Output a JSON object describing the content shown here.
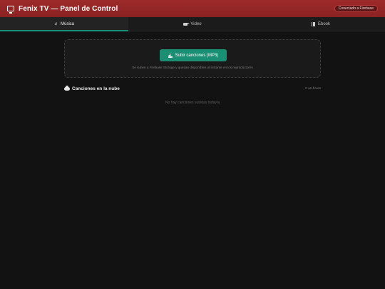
{
  "header": {
    "title": "Fenix TV — Panel de Control",
    "badge": "Conectado a Firebase",
    "icon": "tv-icon"
  },
  "tabs": [
    {
      "label": "Música",
      "icon": "music-icon",
      "active": true
    },
    {
      "label": "Video",
      "icon": "video-icon",
      "active": false
    },
    {
      "label": "Ebook",
      "icon": "book-icon",
      "active": false
    }
  ],
  "upload": {
    "button_label": "Subir canciones (MP3)",
    "icon": "upload-icon",
    "hint": "Se suben a Firebase Storage y quedan disponibles al instante en los reproductores"
  },
  "songs": {
    "title": "Canciones en la nube",
    "icon": "cloud-icon",
    "count": "0 archivos",
    "empty_message": "No hay canciones subidas todavía"
  },
  "colors": {
    "header_bg": "#9e2a2a",
    "accent": "#1a8f73",
    "background": "#121212"
  }
}
